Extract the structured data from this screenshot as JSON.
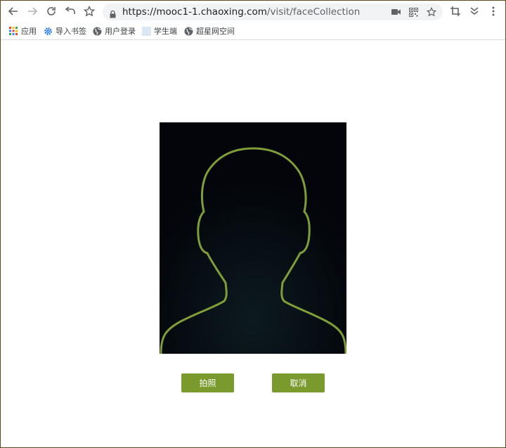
{
  "browser": {
    "url_host": "https://mooc1-1.chaoxing.com",
    "url_path": "/visit/faceCollection"
  },
  "bookmarks": [
    {
      "label": "应用",
      "icon": "apps-grid-icon"
    },
    {
      "label": "导入书签",
      "icon": "gear-icon"
    },
    {
      "label": "用户登录",
      "icon": "globe-icon"
    },
    {
      "label": "学生端",
      "icon": "page-icon"
    },
    {
      "label": "超星网空间",
      "icon": "globe-icon"
    }
  ],
  "page": {
    "capture_label": "拍照",
    "cancel_label": "取消"
  },
  "colors": {
    "accent": "#7a9a2e",
    "outline": "#7f9e39",
    "photo_bg": "#03050a"
  }
}
